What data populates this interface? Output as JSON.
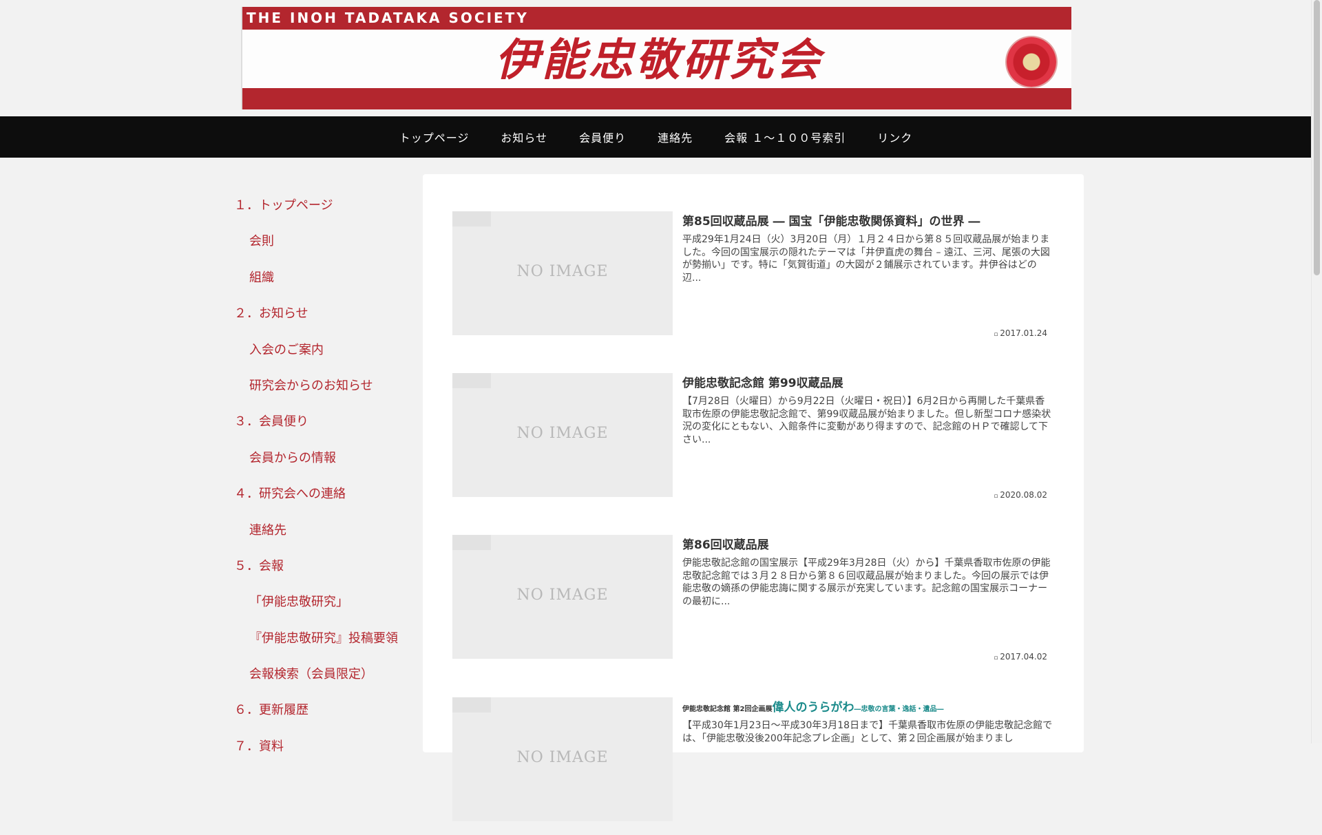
{
  "banner": {
    "society_name": "THE INOH TADATAKA SOCIETY",
    "logo_text": "伊能忠敬研究会"
  },
  "nav": {
    "items": [
      "トップページ",
      "お知らせ",
      "会員便り",
      "連絡先",
      "会報 １～１００号索引",
      "リンク"
    ]
  },
  "sidebar": {
    "items": [
      {
        "label": "１．トップページ",
        "level": 1
      },
      {
        "label": "会則",
        "level": 2
      },
      {
        "label": "組織",
        "level": 2
      },
      {
        "label": "２．お知らせ",
        "level": 1
      },
      {
        "label": "入会のご案内",
        "level": 2
      },
      {
        "label": "研究会からのお知らせ",
        "level": 2
      },
      {
        "label": "３．会員便り",
        "level": 1
      },
      {
        "label": "会員からの情報",
        "level": 2
      },
      {
        "label": "４．研究会への連絡",
        "level": 1
      },
      {
        "label": "連絡先",
        "level": 2
      },
      {
        "label": "５．会報",
        "level": 1
      },
      {
        "label": "「伊能忠敬研究」",
        "level": 2
      },
      {
        "label": "『伊能忠敬研究』投稿要領",
        "level": 2
      },
      {
        "label": "会報検索（会員限定）",
        "level": 2
      },
      {
        "label": "６．更新履歴",
        "level": 1
      },
      {
        "label": "７．資料",
        "level": 1
      }
    ]
  },
  "posts": [
    {
      "thumb_text": "NO IMAGE",
      "title": "第85回収蔵品展 ― 国宝「伊能忠敬関係資料」の世界 ―",
      "snippet": "平成29年1月24日（火）3月20日（月）１月２４日から第８５回収蔵品展が始まりました。今回の国宝展示の隠れたテーマは「井伊直虎の舞台 – 遠江、三河、尾張の大図が勢揃い」です。特に「気賀街道」の大図が２鋪展示されています。井伊谷はどの辺...",
      "date": "2017.01.24"
    },
    {
      "thumb_text": "NO IMAGE",
      "title": "伊能忠敬記念館 第99収蔵品展",
      "snippet": "【7月28日（火曜日）から9月22日（火曜日・祝日）】6月2日から再開した千葉県香取市佐原の伊能忠敬記念館で、第99収蔵品展が始まりました。但し新型コロナ感染状況の変化にともない、入館条件に変動があり得ますので、記念館のＨＰで確認して下さい...",
      "date": "2020.08.02"
    },
    {
      "thumb_text": "NO IMAGE",
      "title": "第86回収蔵品展",
      "snippet": "伊能忠敬記念館の国宝展示【平成29年3月28日（火）から】千葉県香取市佐原の伊能忠敬記念館では３月２８日から第８６回収蔵品展が始まりました。今回の展示では伊能忠敬の嫡孫の伊能忠誨に関する展示が充実しています。記念館の国宝展示コーナーの最初に...",
      "date": "2017.04.02"
    },
    {
      "thumb_text": "NO IMAGE",
      "title_prefix": "伊能忠敬記念館 第2回企画展",
      "title_main": "偉人のうらがわ",
      "title_suffix": "―忠敬の言葉・逸話・遺品―",
      "snippet": "【平成30年1月23日～平成30年3月18日まで】千葉県香取市佐原の伊能忠敬記念館では、「伊能忠敬没後200年記念プレ企画」として、第２回企画展が始まりまし",
      "date": ""
    }
  ]
}
